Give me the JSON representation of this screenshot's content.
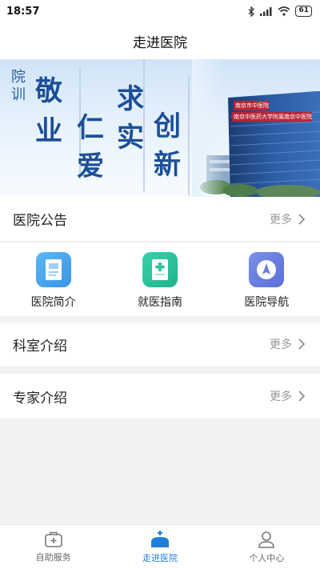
{
  "status": {
    "time": "18:57",
    "battery": "61"
  },
  "header": {
    "title": "走进医院"
  },
  "banner": {
    "motto_label": [
      "院",
      "训"
    ],
    "chars": [
      "敬",
      "业",
      "仁",
      "爱",
      "求",
      "实",
      "创",
      "新"
    ],
    "sign_lines": [
      "南京市中医院",
      "南京中医药大学附属南京中医院"
    ]
  },
  "sections": {
    "announcements": {
      "label": "医院公告",
      "more": "更多"
    },
    "departments": {
      "label": "科室介绍",
      "more": "更多"
    },
    "experts": {
      "label": "专家介绍",
      "more": "更多"
    }
  },
  "shortcuts": [
    {
      "label": "医院简介",
      "icon": "document-icon",
      "color": "#4aa9ee"
    },
    {
      "label": "就医指南",
      "icon": "medical-guide-icon",
      "color": "#2fc4a0"
    },
    {
      "label": "医院导航",
      "icon": "navigation-icon",
      "color": "#6b7fe0"
    }
  ],
  "tabbar": {
    "items": [
      {
        "label": "自助服务",
        "icon": "medical-kit-icon"
      },
      {
        "label": "走进医院",
        "icon": "hospital-icon"
      },
      {
        "label": "个人中心",
        "icon": "user-icon"
      }
    ],
    "active_color": "#1e7fd8"
  }
}
